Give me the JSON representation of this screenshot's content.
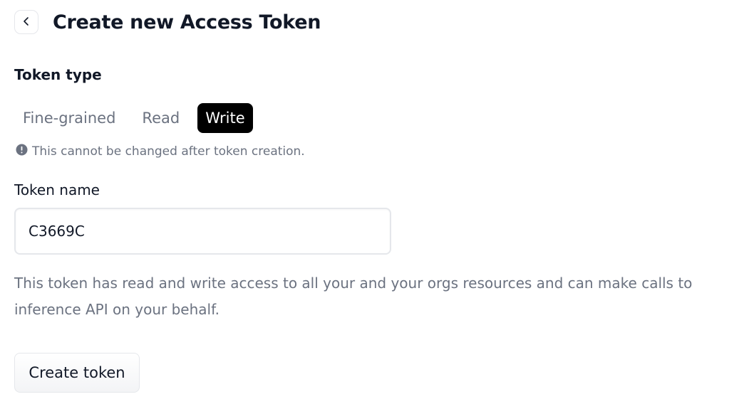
{
  "header": {
    "back_icon": "chevron-left-icon",
    "title": "Create new Access Token"
  },
  "token_type": {
    "label": "Token type",
    "options": [
      "Fine-grained",
      "Read",
      "Write"
    ],
    "selected": "Write",
    "notice_icon": "exclamation-circle-icon",
    "notice": "This cannot be changed after token creation."
  },
  "token_name": {
    "label": "Token name",
    "value": "C3669C"
  },
  "description": "This token has read and write access to all your and your orgs resources and can make calls to inference API on your behalf.",
  "actions": {
    "create_label": "Create token"
  },
  "colors": {
    "selected_tab_bg": "#000000",
    "selected_tab_text": "#ffffff",
    "muted_text": "#6b7280",
    "border": "#e5e7eb"
  }
}
